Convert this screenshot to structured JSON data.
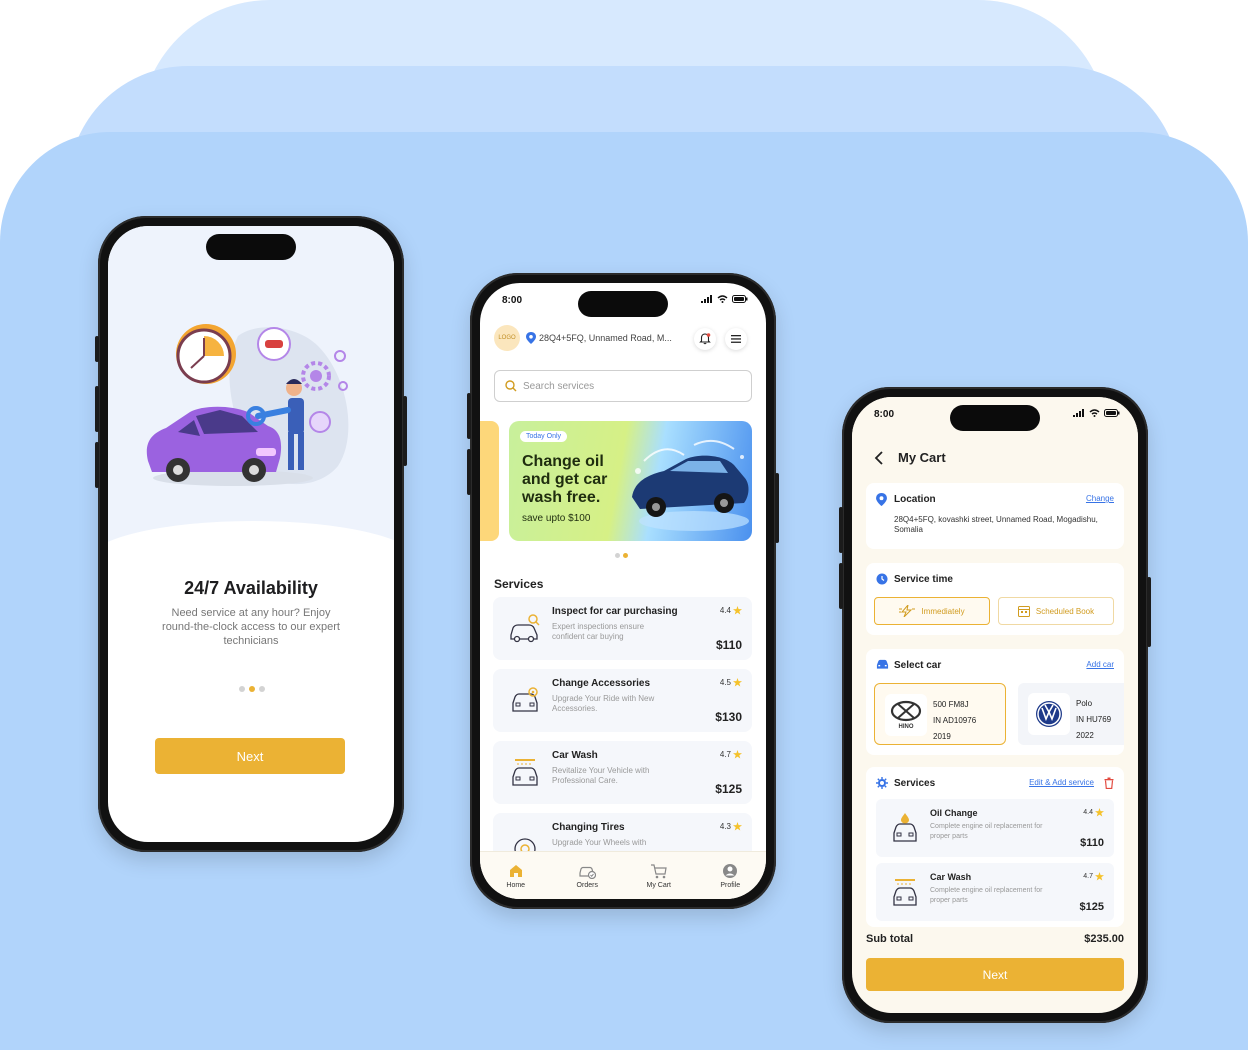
{
  "colors": {
    "accent": "#ebb234",
    "link": "#3773e6",
    "background": "#b1d4fb"
  },
  "onboarding": {
    "title": "24/7 Availability",
    "description": "Need service at any hour? Enjoy round-the-clock access to our expert technicians",
    "page_indicator": {
      "current": 2,
      "total": 3
    },
    "next_label": "Next"
  },
  "home": {
    "status_time": "8:00",
    "logo_text": "LOGO",
    "location": "28Q4+5FQ, Unnamed Road, M...",
    "search_placeholder": "Search services",
    "banner": {
      "badge": "Today Only",
      "title": "Change oil and get car wash free.",
      "subtitle": "save upto $100"
    },
    "banner_indicator": {
      "current": 2,
      "total": 2
    },
    "services_title": "Services",
    "services": [
      {
        "name": "Inspect for car purchasing",
        "desc": "Expert inspections ensure confident car buying",
        "rating": "4.4",
        "price": "$110",
        "icon": "car-inspect-icon"
      },
      {
        "name": "Change Accessories",
        "desc": "Upgrade Your Ride with New Accessories.",
        "rating": "4.5",
        "price": "$130",
        "icon": "car-accessory-icon"
      },
      {
        "name": "Car Wash",
        "desc": "Revitalize Your Vehicle with Professional Care.",
        "rating": "4.7",
        "price": "$125",
        "icon": "car-wash-icon"
      },
      {
        "name": "Changing Tires",
        "desc": "Upgrade Your Wheels with",
        "rating": "4.3",
        "price": "",
        "icon": "tire-icon"
      }
    ],
    "tabs": [
      {
        "label": "Home",
        "icon": "home-icon",
        "active": true
      },
      {
        "label": "Orders",
        "icon": "orders-icon",
        "active": false
      },
      {
        "label": "My Cart",
        "icon": "cart-icon",
        "active": false
      },
      {
        "label": "Profile",
        "icon": "profile-icon",
        "active": false
      }
    ]
  },
  "cart": {
    "status_time": "8:00",
    "title": "My Cart",
    "location": {
      "title": "Location",
      "change_label": "Change",
      "address": "28Q4+5FQ, kovashki street, Unnamed Road, Mogadishu, Somalia"
    },
    "service_time": {
      "title": "Service time",
      "immediately_label": "Immediately",
      "scheduled_label": "Scheduled Book"
    },
    "select_car": {
      "title": "Select car",
      "add_label": "Add car",
      "cars": [
        {
          "brand": "HINO",
          "model": "500 FM8J",
          "plate": "IN AD10976",
          "year": "2019",
          "selected": true
        },
        {
          "brand": "VW",
          "model": "Polo",
          "plate": "IN HU769",
          "year": "2022",
          "selected": false
        }
      ]
    },
    "services": {
      "title": "Services",
      "edit_label": "Edit & Add service",
      "items": [
        {
          "name": "Oil Change",
          "desc": "Complete engine oil replacement for proper parts",
          "rating": "4.4",
          "price": "$110"
        },
        {
          "name": "Car Wash",
          "desc": "Complete engine oil replacement for proper parts",
          "rating": "4.7",
          "price": "$125"
        }
      ]
    },
    "subtotal_label": "Sub total",
    "subtotal_value": "$235.00",
    "next_label": "Next"
  }
}
